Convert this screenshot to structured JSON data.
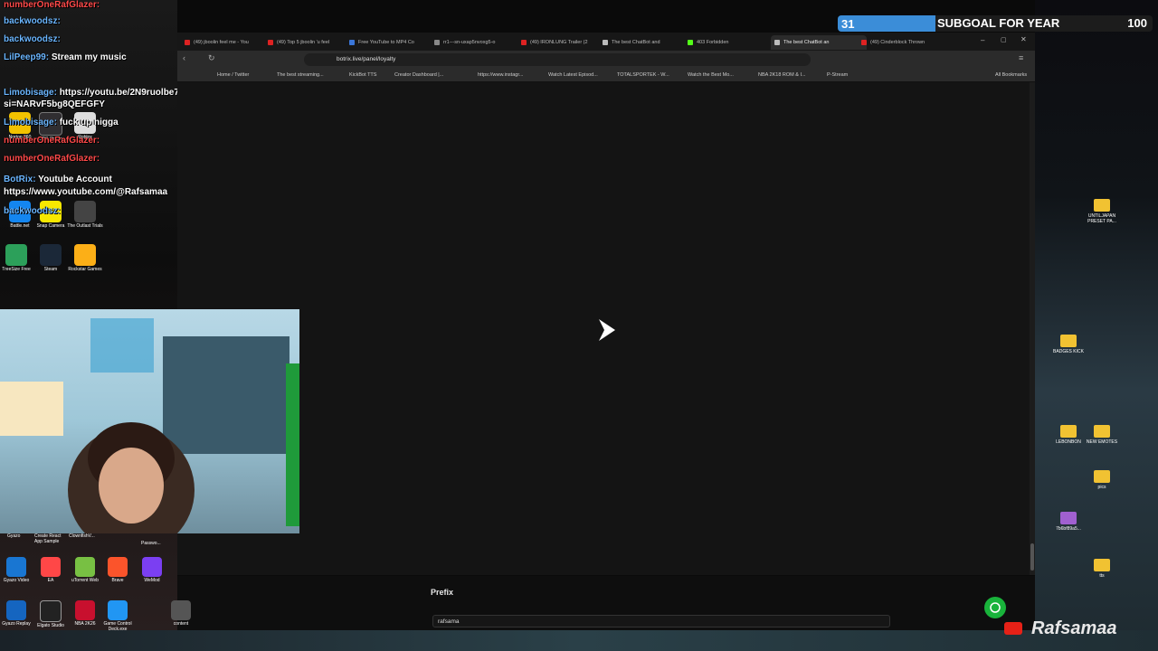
{
  "subgoal": {
    "count": "31",
    "label": "SUBGOAL FOR YEAR",
    "target": "100",
    "progress_fraction": 0.31
  },
  "chat": [
    {
      "user": "numberOneRafGlazer:",
      "text": "",
      "color": "red"
    },
    {
      "user": "backwoodsz:",
      "text": "",
      "color": "blue"
    },
    {
      "user": "backwoodsz:",
      "text": "",
      "color": "blue"
    },
    {
      "user": "LilPeep99:",
      "text": "Stream my music",
      "color": "blue"
    },
    {
      "user": "Limobisage:",
      "text": "https://youtu.be/2N9ruolbe7U?si=NARvF5bg8QEFGFY",
      "color": "blue"
    },
    {
      "user": "Limobisage:",
      "text": "fuck up nigga",
      "color": "blue"
    },
    {
      "user": "numberOneRafGlazer:",
      "text": "",
      "color": "red"
    },
    {
      "user": "numberOneRafGlazer:",
      "text": "",
      "color": "red"
    },
    {
      "user": "BotRix:",
      "text": "Youtube Account https://www.youtube.com/@Rafsamaa",
      "color": "blue"
    },
    {
      "user": "backwoodsz:",
      "text": "",
      "color": "blue"
    }
  ],
  "desktop_icons": [
    "Norton 360",
    "OBS Studio",
    "Roblox",
    "Battle.net",
    "Snap Camera",
    "The Outlast Trials",
    "TreeSize Free",
    "Steam",
    "Rockstar Games"
  ],
  "browser": {
    "tabs": [
      "(49) jboolin feel me - You",
      "(49) Top 5 jboolin 'u feel",
      "Free YouTube to MP4 Co",
      "rr1---sn-uxap5nvoxg5-o",
      "(49) IRONLUNG Trailer (2",
      "The best ChatBot and",
      "403 Forbidden",
      "The best ChatBot an",
      "(49) Cinderblock Thrown"
    ],
    "url": "botrix.live/panel/loyalty",
    "bookmarks": [
      "Home / Twitter",
      "The best streaming...",
      "KickBot TTS",
      "Creator Dashboard |...",
      "https://www.instagr...",
      "Watch Latest Episod...",
      "TOTALSPORTEK - W...",
      "Watch the Best Mo...",
      "NBA 2K18 ROM & I...",
      "P-Stream",
      "All Bookmarks"
    ]
  },
  "panel": {
    "prefix_label": "Prefix",
    "prefix_value": "rafsama"
  },
  "right_folders": [
    "UNTILJAPAN PRESET PA...",
    "BADGES KICK",
    "LEBONBON",
    "NEW EMOTES",
    "pics",
    "7b6bf89a5...",
    "tts"
  ],
  "taskbar_apps": [
    "Gyazo Video",
    "EA",
    "uTorrent Web",
    "Brave",
    "WeMod",
    "Gyazo Replay",
    "Elgato Studio",
    "NBA 2K26",
    "Game Control Deck.exe",
    "content"
  ],
  "taskbar_top_labels": [
    "Gyazo",
    "Create React App Sample",
    "ClownfishV...",
    "Passwo..."
  ],
  "watermark": "Rafsamaa",
  "colors": {
    "accent_blue": "#3b8dd8",
    "fab_green": "#19b33b",
    "yt_red": "#e62117"
  }
}
